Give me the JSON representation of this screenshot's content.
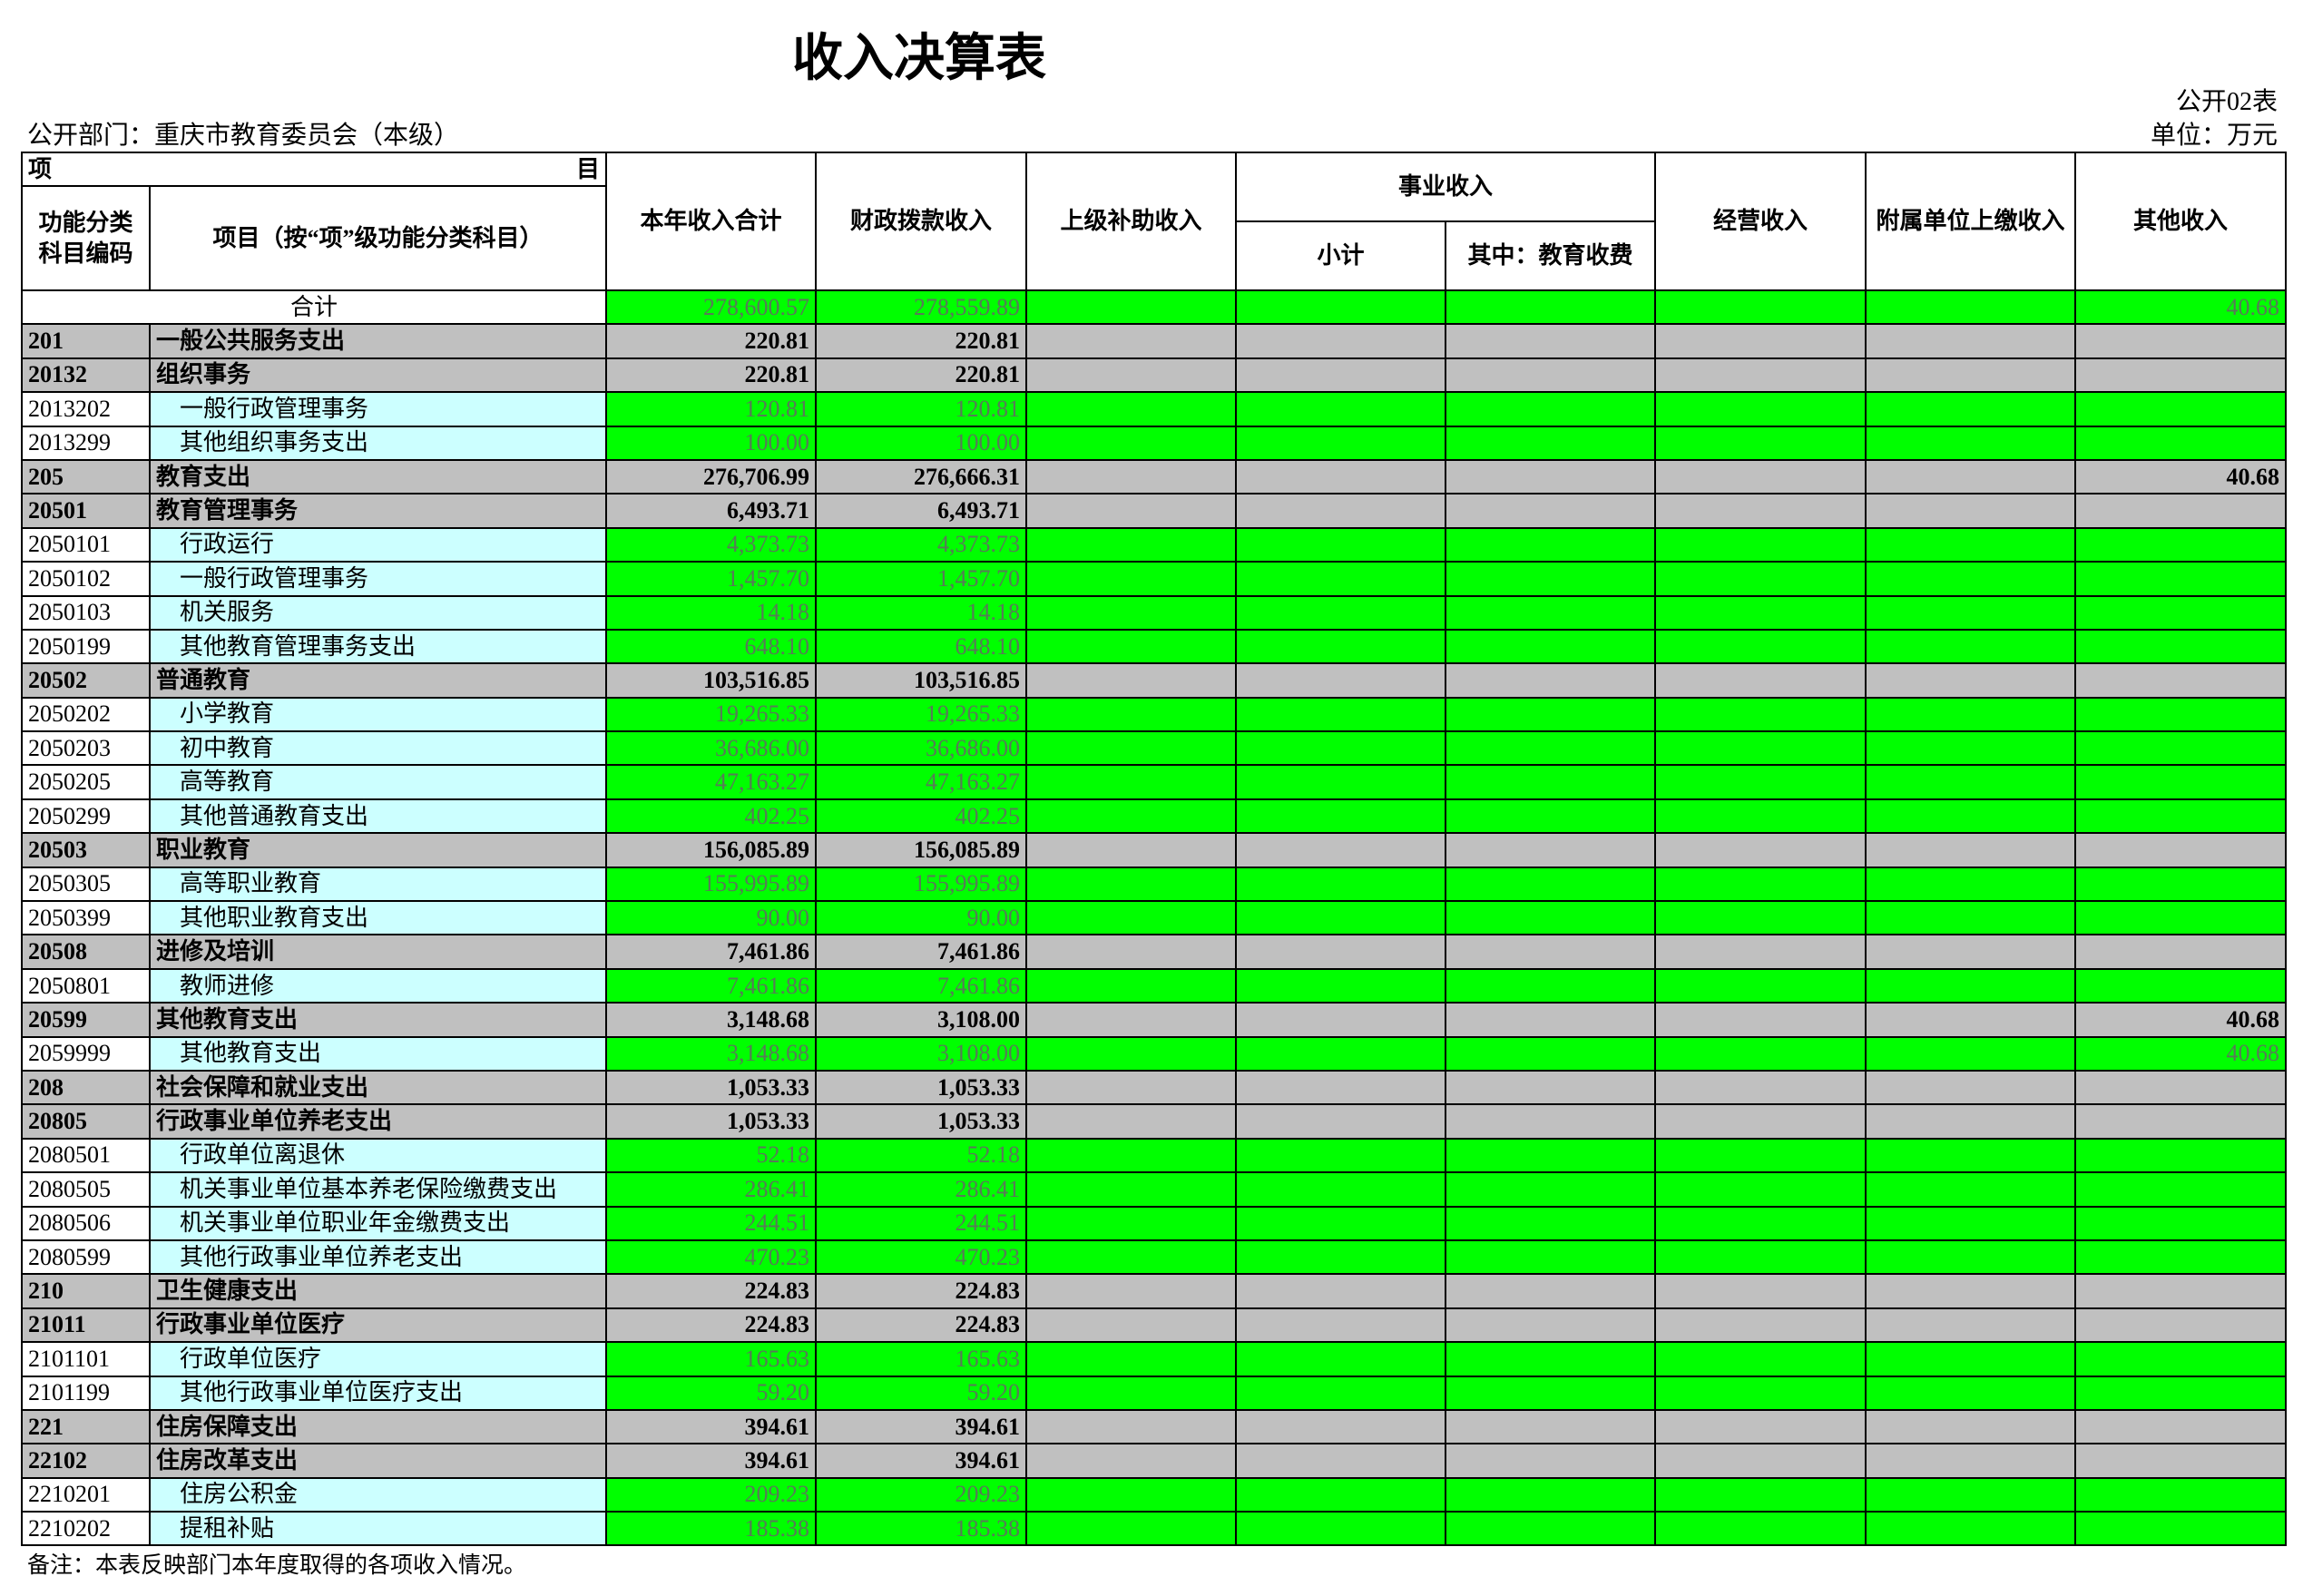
{
  "title": "收入决算表",
  "form_no": "公开02表",
  "department": "公开部门：重庆市教育委员会（本级）",
  "unit": "单位：万元",
  "header": {
    "item_left": "项",
    "item_right": "目",
    "code_label": [
      "功能分类",
      "科目编码"
    ],
    "name_label": "项目（按“项”级功能分类科目）",
    "total_income": "本年收入合计",
    "fiscal_appropriation": "财政拨款收入",
    "superior_subsidy": "上级补助收入",
    "business_income": "事业收入",
    "business_subtotal": "小计",
    "business_education_fees": "其中：教育收费",
    "operating_income": "经营收入",
    "affiliated_remittance": "附属单位上缴收入",
    "other_income": "其他收入"
  },
  "total_row": {
    "label": "合计",
    "values": [
      "278,600.57",
      "278,559.89",
      "",
      "",
      "",
      "",
      "",
      "40.68"
    ]
  },
  "rows": [
    {
      "code": "201",
      "name": "一般公共服务支出",
      "values": [
        "220.81",
        "220.81",
        "",
        "",
        "",
        "",
        "",
        ""
      ]
    },
    {
      "code": "20132",
      "name": "组织事务",
      "values": [
        "220.81",
        "220.81",
        "",
        "",
        "",
        "",
        "",
        ""
      ]
    },
    {
      "code": "2013202",
      "name": "一般行政管理事务",
      "values": [
        "120.81",
        "120.81",
        "",
        "",
        "",
        "",
        "",
        ""
      ]
    },
    {
      "code": "2013299",
      "name": "其他组织事务支出",
      "values": [
        "100.00",
        "100.00",
        "",
        "",
        "",
        "",
        "",
        ""
      ]
    },
    {
      "code": "205",
      "name": "教育支出",
      "values": [
        "276,706.99",
        "276,666.31",
        "",
        "",
        "",
        "",
        "",
        "40.68"
      ]
    },
    {
      "code": "20501",
      "name": "教育管理事务",
      "values": [
        "6,493.71",
        "6,493.71",
        "",
        "",
        "",
        "",
        "",
        ""
      ]
    },
    {
      "code": "2050101",
      "name": "行政运行",
      "values": [
        "4,373.73",
        "4,373.73",
        "",
        "",
        "",
        "",
        "",
        ""
      ]
    },
    {
      "code": "2050102",
      "name": "一般行政管理事务",
      "values": [
        "1,457.70",
        "1,457.70",
        "",
        "",
        "",
        "",
        "",
        ""
      ]
    },
    {
      "code": "2050103",
      "name": "机关服务",
      "values": [
        "14.18",
        "14.18",
        "",
        "",
        "",
        "",
        "",
        ""
      ]
    },
    {
      "code": "2050199",
      "name": "其他教育管理事务支出",
      "values": [
        "648.10",
        "648.10",
        "",
        "",
        "",
        "",
        "",
        ""
      ]
    },
    {
      "code": "20502",
      "name": "普通教育",
      "values": [
        "103,516.85",
        "103,516.85",
        "",
        "",
        "",
        "",
        "",
        ""
      ]
    },
    {
      "code": "2050202",
      "name": "小学教育",
      "values": [
        "19,265.33",
        "19,265.33",
        "",
        "",
        "",
        "",
        "",
        ""
      ]
    },
    {
      "code": "2050203",
      "name": "初中教育",
      "values": [
        "36,686.00",
        "36,686.00",
        "",
        "",
        "",
        "",
        "",
        ""
      ]
    },
    {
      "code": "2050205",
      "name": "高等教育",
      "values": [
        "47,163.27",
        "47,163.27",
        "",
        "",
        "",
        "",
        "",
        ""
      ]
    },
    {
      "code": "2050299",
      "name": "其他普通教育支出",
      "values": [
        "402.25",
        "402.25",
        "",
        "",
        "",
        "",
        "",
        ""
      ]
    },
    {
      "code": "20503",
      "name": "职业教育",
      "values": [
        "156,085.89",
        "156,085.89",
        "",
        "",
        "",
        "",
        "",
        ""
      ]
    },
    {
      "code": "2050305",
      "name": "高等职业教育",
      "values": [
        "155,995.89",
        "155,995.89",
        "",
        "",
        "",
        "",
        "",
        ""
      ]
    },
    {
      "code": "2050399",
      "name": "其他职业教育支出",
      "values": [
        "90.00",
        "90.00",
        "",
        "",
        "",
        "",
        "",
        ""
      ]
    },
    {
      "code": "20508",
      "name": "进修及培训",
      "values": [
        "7,461.86",
        "7,461.86",
        "",
        "",
        "",
        "",
        "",
        ""
      ]
    },
    {
      "code": "2050801",
      "name": "教师进修",
      "values": [
        "7,461.86",
        "7,461.86",
        "",
        "",
        "",
        "",
        "",
        ""
      ]
    },
    {
      "code": "20599",
      "name": "其他教育支出",
      "values": [
        "3,148.68",
        "3,108.00",
        "",
        "",
        "",
        "",
        "",
        "40.68"
      ]
    },
    {
      "code": "2059999",
      "name": "其他教育支出",
      "values": [
        "3,148.68",
        "3,108.00",
        "",
        "",
        "",
        "",
        "",
        "40.68"
      ]
    },
    {
      "code": "208",
      "name": "社会保障和就业支出",
      "values": [
        "1,053.33",
        "1,053.33",
        "",
        "",
        "",
        "",
        "",
        ""
      ]
    },
    {
      "code": "20805",
      "name": "行政事业单位养老支出",
      "values": [
        "1,053.33",
        "1,053.33",
        "",
        "",
        "",
        "",
        "",
        ""
      ]
    },
    {
      "code": "2080501",
      "name": "行政单位离退休",
      "values": [
        "52.18",
        "52.18",
        "",
        "",
        "",
        "",
        "",
        ""
      ]
    },
    {
      "code": "2080505",
      "name": "机关事业单位基本养老保险缴费支出",
      "values": [
        "286.41",
        "286.41",
        "",
        "",
        "",
        "",
        "",
        ""
      ]
    },
    {
      "code": "2080506",
      "name": "机关事业单位职业年金缴费支出",
      "values": [
        "244.51",
        "244.51",
        "",
        "",
        "",
        "",
        "",
        ""
      ]
    },
    {
      "code": "2080599",
      "name": "其他行政事业单位养老支出",
      "values": [
        "470.23",
        "470.23",
        "",
        "",
        "",
        "",
        "",
        ""
      ]
    },
    {
      "code": "210",
      "name": "卫生健康支出",
      "values": [
        "224.83",
        "224.83",
        "",
        "",
        "",
        "",
        "",
        ""
      ]
    },
    {
      "code": "21011",
      "name": "行政事业单位医疗",
      "values": [
        "224.83",
        "224.83",
        "",
        "",
        "",
        "",
        "",
        ""
      ]
    },
    {
      "code": "2101101",
      "name": "行政单位医疗",
      "values": [
        "165.63",
        "165.63",
        "",
        "",
        "",
        "",
        "",
        ""
      ]
    },
    {
      "code": "2101199",
      "name": "其他行政事业单位医疗支出",
      "values": [
        "59.20",
        "59.20",
        "",
        "",
        "",
        "",
        "",
        ""
      ]
    },
    {
      "code": "221",
      "name": "住房保障支出",
      "values": [
        "394.61",
        "394.61",
        "",
        "",
        "",
        "",
        "",
        ""
      ]
    },
    {
      "code": "22102",
      "name": "住房改革支出",
      "values": [
        "394.61",
        "394.61",
        "",
        "",
        "",
        "",
        "",
        ""
      ]
    },
    {
      "code": "2210201",
      "name": "住房公积金",
      "values": [
        "209.23",
        "209.23",
        "",
        "",
        "",
        "",
        "",
        ""
      ]
    },
    {
      "code": "2210202",
      "name": "提租补贴",
      "values": [
        "185.38",
        "185.38",
        "",
        "",
        "",
        "",
        "",
        ""
      ]
    }
  ],
  "note": "备注：本表反映部门本年度取得的各项收入情况。",
  "colors": {
    "value_cell": "#00FF00",
    "group_row": "#C0C0C0",
    "item_name_cell": "#CCFFFF"
  }
}
